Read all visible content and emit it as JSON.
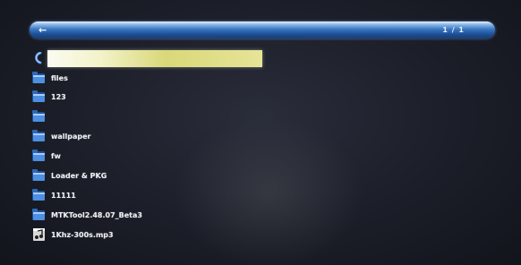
{
  "header": {
    "back_label": "←",
    "page_indicator": "1 / 1"
  },
  "list": {
    "items": [
      {
        "label": "",
        "icon": "return-arrow-icon"
      },
      {
        "label": "files",
        "icon": "folder-icon"
      },
      {
        "label": "123",
        "icon": "folder-icon"
      },
      {
        "label": "",
        "icon": "folder-icon"
      },
      {
        "label": "wallpaper",
        "icon": "folder-icon"
      },
      {
        "label": "fw",
        "icon": "folder-icon"
      },
      {
        "label": "Loader & PKG",
        "icon": "folder-icon"
      },
      {
        "label": "11111",
        "icon": "folder-icon"
      },
      {
        "label": "MTKTool2.48.07_Beta3",
        "icon": "folder-icon"
      },
      {
        "label": "1Khz-300s.mp3",
        "icon": "music-file-icon"
      }
    ]
  },
  "colors": {
    "path_bar": "#2d66ad",
    "selection": "#e8e79a",
    "folder_blue": "#3f7fcf",
    "text": "#eef0f4"
  }
}
